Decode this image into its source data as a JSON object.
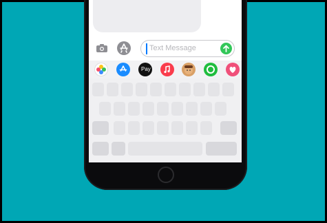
{
  "compose": {
    "placeholder": "Text Message"
  },
  "app_strip": {
    "icons": [
      {
        "name": "photos-app-icon",
        "color": "#ffffff"
      },
      {
        "name": "app-store-icon",
        "color": "#1a8cff"
      },
      {
        "name": "apple-pay-icon",
        "label": "Pay",
        "color": "#111111"
      },
      {
        "name": "music-app-icon",
        "color": "#fa3c4c"
      },
      {
        "name": "memoji-icon",
        "color": "#d9a066"
      },
      {
        "name": "activity-app-icon",
        "color": "#1fbd3e"
      },
      {
        "name": "heart-app-icon",
        "color": "#f0507a"
      }
    ]
  },
  "colors": {
    "background": "#00a7b5",
    "phone_body": "#0b0b0d",
    "send_button": "#33c759",
    "caret": "#007aff"
  }
}
